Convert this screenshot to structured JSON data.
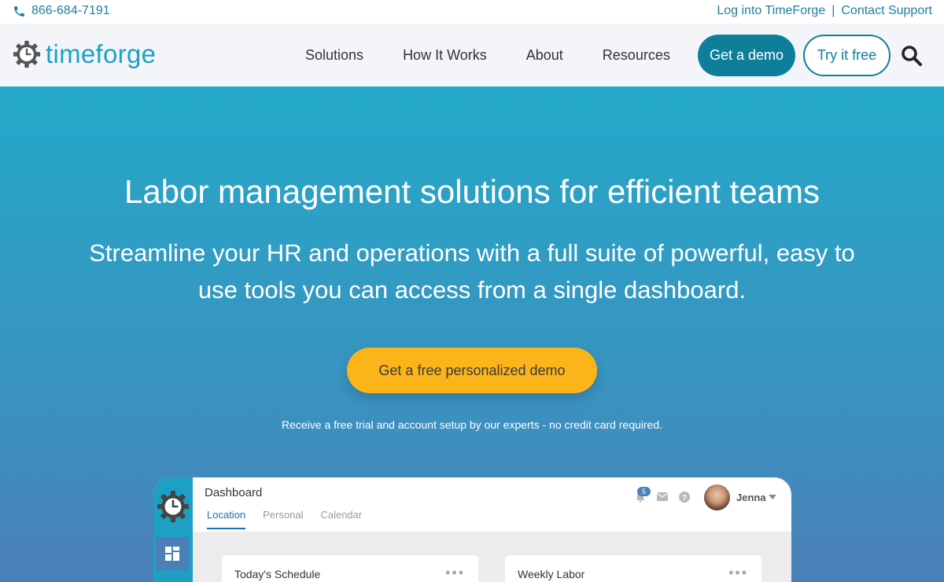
{
  "topbar": {
    "phone": "866-684-7191",
    "login_link": "Log into TimeForge",
    "separator": "|",
    "support_link": "Contact Support"
  },
  "nav": {
    "logo_text": "timeforge",
    "menu": [
      "Solutions",
      "How It Works",
      "About",
      "Resources"
    ],
    "demo_button": "Get a demo",
    "try_button": "Try it free",
    "search_icon": "search-icon"
  },
  "hero": {
    "title": "Labor management solutions for efficient teams",
    "subtitle": "Streamline your HR and operations with a full suite of powerful, easy to use tools you can access from a single dashboard.",
    "cta": "Get a free personalized demo",
    "note": "Receive a free trial and account setup by our experts - no credit card required."
  },
  "dashboard": {
    "title": "Dashboard",
    "tabs": [
      "Location",
      "Personal",
      "Calendar"
    ],
    "active_tab": "Location",
    "notification_count": "5",
    "user_name": "Jenna",
    "cards": [
      "Today's Schedule",
      "Weekly Labor"
    ],
    "card_menu": "•••"
  },
  "colors": {
    "brand_teal": "#1aa1c4",
    "dark_teal": "#0d7f9a",
    "cta_yellow": "#fbb419",
    "hero_top": "#23a9c9",
    "hero_bottom": "#4a7fb8"
  }
}
